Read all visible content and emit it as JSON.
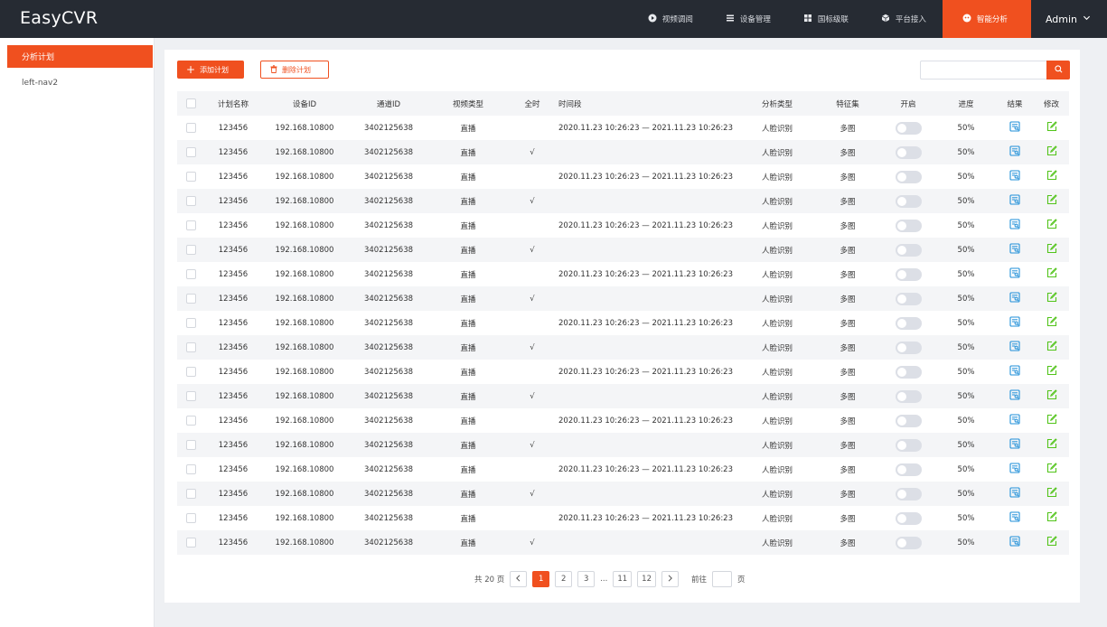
{
  "app": {
    "title": "EasyCVR"
  },
  "nav": {
    "items": [
      {
        "label": "视频调阅",
        "icon": "play-circle-icon"
      },
      {
        "label": "设备管理",
        "icon": "list-icon"
      },
      {
        "label": "国标级联",
        "icon": "grid-icon"
      },
      {
        "label": "平台接入",
        "icon": "cube-icon"
      },
      {
        "label": "智能分析",
        "icon": "ai-icon",
        "active": true
      }
    ],
    "user": "Admin"
  },
  "sidebar": {
    "items": [
      {
        "label": "分析计划",
        "active": true
      },
      {
        "label": "left-nav2"
      }
    ]
  },
  "toolbar": {
    "add_label": "添加计划",
    "delete_label": "删除计划",
    "search_placeholder": ""
  },
  "table": {
    "headers": [
      "计划名称",
      "设备ID",
      "通道ID",
      "视频类型",
      "全时",
      "时间段",
      "分析类型",
      "特征集",
      "开启",
      "进度",
      "结果",
      "修改"
    ],
    "rows": [
      {
        "name": "123456",
        "device": "192.168.10800",
        "channel": "3402125638",
        "type": "直播",
        "fulltime": "",
        "period": "2020.11.23 10:26:23 — 2021.11.23 10:26:23",
        "analysis": "人脸识别",
        "features": "多图",
        "progress": "50%"
      },
      {
        "name": "123456",
        "device": "192.168.10800",
        "channel": "3402125638",
        "type": "直播",
        "fulltime": "√",
        "period": "",
        "analysis": "人脸识别",
        "features": "多图",
        "progress": "50%"
      },
      {
        "name": "123456",
        "device": "192.168.10800",
        "channel": "3402125638",
        "type": "直播",
        "fulltime": "",
        "period": "2020.11.23 10:26:23 — 2021.11.23 10:26:23",
        "analysis": "人脸识别",
        "features": "多图",
        "progress": "50%"
      },
      {
        "name": "123456",
        "device": "192.168.10800",
        "channel": "3402125638",
        "type": "直播",
        "fulltime": "√",
        "period": "",
        "analysis": "人脸识别",
        "features": "多图",
        "progress": "50%"
      },
      {
        "name": "123456",
        "device": "192.168.10800",
        "channel": "3402125638",
        "type": "直播",
        "fulltime": "",
        "period": "2020.11.23 10:26:23 — 2021.11.23 10:26:23",
        "analysis": "人脸识别",
        "features": "多图",
        "progress": "50%"
      },
      {
        "name": "123456",
        "device": "192.168.10800",
        "channel": "3402125638",
        "type": "直播",
        "fulltime": "√",
        "period": "",
        "analysis": "人脸识别",
        "features": "多图",
        "progress": "50%"
      },
      {
        "name": "123456",
        "device": "192.168.10800",
        "channel": "3402125638",
        "type": "直播",
        "fulltime": "",
        "period": "2020.11.23 10:26:23 — 2021.11.23 10:26:23",
        "analysis": "人脸识别",
        "features": "多图",
        "progress": "50%"
      },
      {
        "name": "123456",
        "device": "192.168.10800",
        "channel": "3402125638",
        "type": "直播",
        "fulltime": "√",
        "period": "",
        "analysis": "人脸识别",
        "features": "多图",
        "progress": "50%"
      },
      {
        "name": "123456",
        "device": "192.168.10800",
        "channel": "3402125638",
        "type": "直播",
        "fulltime": "",
        "period": "2020.11.23 10:26:23 — 2021.11.23 10:26:23",
        "analysis": "人脸识别",
        "features": "多图",
        "progress": "50%"
      },
      {
        "name": "123456",
        "device": "192.168.10800",
        "channel": "3402125638",
        "type": "直播",
        "fulltime": "√",
        "period": "",
        "analysis": "人脸识别",
        "features": "多图",
        "progress": "50%"
      },
      {
        "name": "123456",
        "device": "192.168.10800",
        "channel": "3402125638",
        "type": "直播",
        "fulltime": "",
        "period": "2020.11.23 10:26:23 — 2021.11.23 10:26:23",
        "analysis": "人脸识别",
        "features": "多图",
        "progress": "50%"
      },
      {
        "name": "123456",
        "device": "192.168.10800",
        "channel": "3402125638",
        "type": "直播",
        "fulltime": "√",
        "period": "",
        "analysis": "人脸识别",
        "features": "多图",
        "progress": "50%"
      },
      {
        "name": "123456",
        "device": "192.168.10800",
        "channel": "3402125638",
        "type": "直播",
        "fulltime": "",
        "period": "2020.11.23 10:26:23 — 2021.11.23 10:26:23",
        "analysis": "人脸识别",
        "features": "多图",
        "progress": "50%"
      },
      {
        "name": "123456",
        "device": "192.168.10800",
        "channel": "3402125638",
        "type": "直播",
        "fulltime": "√",
        "period": "",
        "analysis": "人脸识别",
        "features": "多图",
        "progress": "50%"
      },
      {
        "name": "123456",
        "device": "192.168.10800",
        "channel": "3402125638",
        "type": "直播",
        "fulltime": "",
        "period": "2020.11.23 10:26:23 — 2021.11.23 10:26:23",
        "analysis": "人脸识别",
        "features": "多图",
        "progress": "50%"
      },
      {
        "name": "123456",
        "device": "192.168.10800",
        "channel": "3402125638",
        "type": "直播",
        "fulltime": "√",
        "period": "",
        "analysis": "人脸识别",
        "features": "多图",
        "progress": "50%"
      },
      {
        "name": "123456",
        "device": "192.168.10800",
        "channel": "3402125638",
        "type": "直播",
        "fulltime": "",
        "period": "2020.11.23 10:26:23 — 2021.11.23 10:26:23",
        "analysis": "人脸识别",
        "features": "多图",
        "progress": "50%"
      },
      {
        "name": "123456",
        "device": "192.168.10800",
        "channel": "3402125638",
        "type": "直播",
        "fulltime": "√",
        "period": "",
        "analysis": "人脸识别",
        "features": "多图",
        "progress": "50%"
      }
    ]
  },
  "pagination": {
    "total_text": "共 20 页",
    "pages": [
      "1",
      "2",
      "3",
      "...",
      "11",
      "12"
    ],
    "current": "1",
    "goto_prefix": "前往",
    "goto_suffix": "页"
  },
  "colors": {
    "accent": "#f0501f",
    "topbar": "#262b33",
    "result_icon": "#1f8fd8",
    "edit_icon": "#52c41a"
  }
}
